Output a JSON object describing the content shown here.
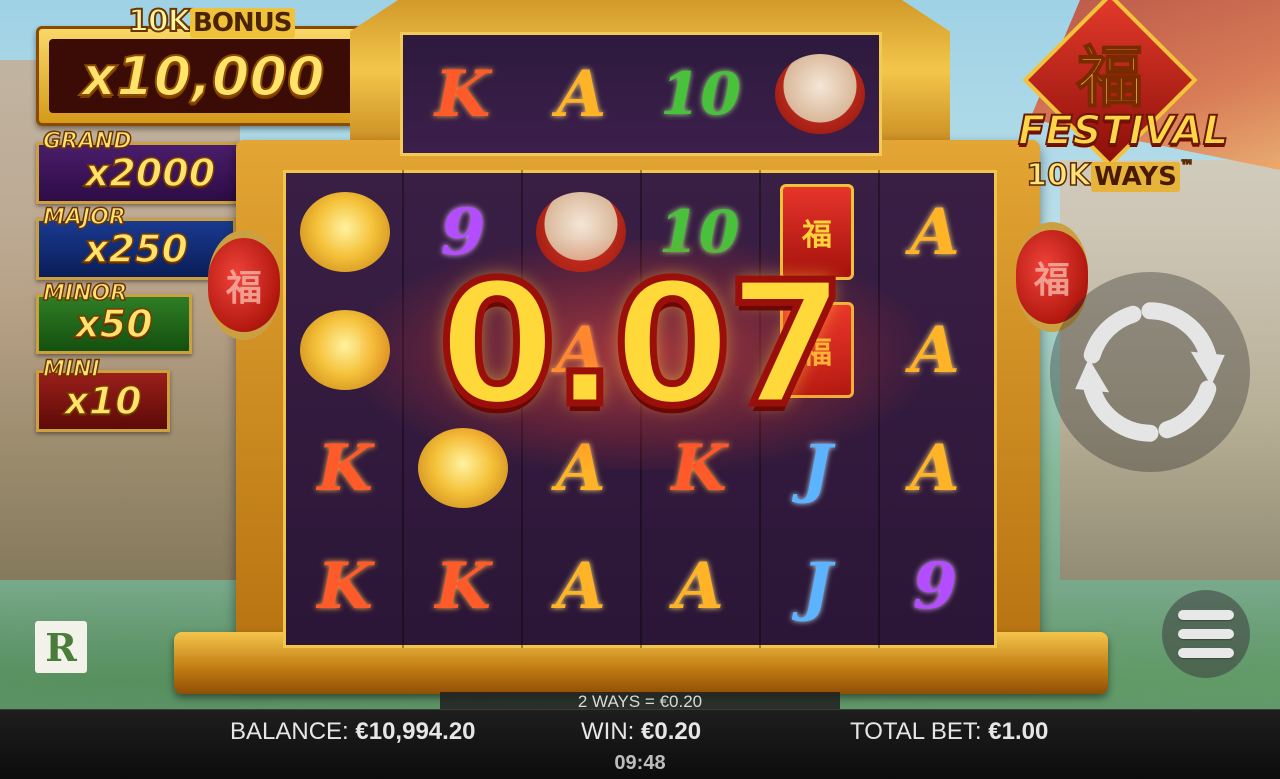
{
  "jackpots": {
    "bonus": {
      "label_prefix": "10K",
      "label_box": "BONUS",
      "value": "x10,000"
    },
    "grand": {
      "label": "GRAND",
      "value": "x2000"
    },
    "major": {
      "label": "MAJOR",
      "value": "x250"
    },
    "minor": {
      "label": "MINOR",
      "value": "x50"
    },
    "mini": {
      "label": "MINI",
      "value": "x10"
    }
  },
  "logo": {
    "glyph": "福",
    "title": "FESTIVAL",
    "ways_prefix": "10K",
    "ways_box": "WAYS",
    "ways_suffix": "™"
  },
  "lanterns": {
    "glyph": "福"
  },
  "top_reel": [
    "K",
    "A",
    "10",
    "drum"
  ],
  "reels": [
    [
      "gold",
      "9",
      "drum",
      "10",
      "envelope",
      "A"
    ],
    [
      "gold",
      "",
      "A",
      "",
      "envelope",
      "A"
    ],
    [
      "K",
      "gold",
      "A",
      "K",
      "J",
      "A"
    ],
    [
      "K",
      "K",
      "A",
      "A",
      "J",
      "9"
    ]
  ],
  "envelope_glyph": "福",
  "win_overlay": {
    "amount": "0.07"
  },
  "ways_info": "2 WAYS = €0.20",
  "status_bar": {
    "balance_label": "BALANCE:",
    "balance_value": "€10,994.20",
    "win_label": "WIN:",
    "win_value": "€0.20",
    "bet_label": "TOTAL BET:",
    "bet_value": "€1.00",
    "clock": "09:48"
  },
  "provider_badge": "R",
  "icons": {
    "spin": "refresh-arrows-icon",
    "menu": "hamburger-menu-icon"
  },
  "colors": {
    "gold": "#ffd93a",
    "win_outline": "#9a0f0a",
    "frame": "#e3a533",
    "bar_background": "#0c0c0c"
  }
}
